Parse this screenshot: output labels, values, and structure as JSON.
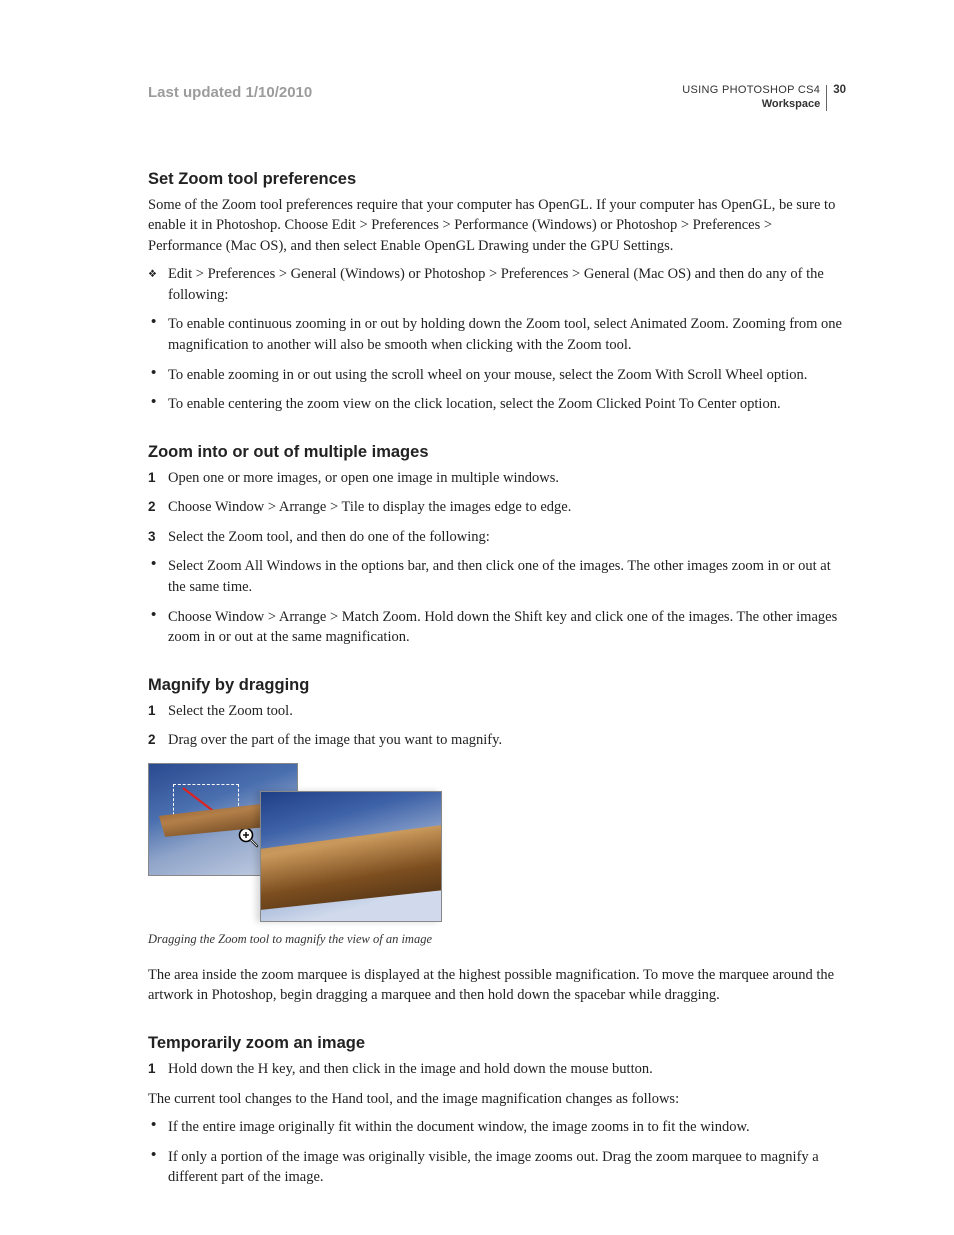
{
  "header": {
    "last_updated": "Last updated 1/10/2010",
    "product": "USING PHOTOSHOP CS4",
    "section": "Workspace",
    "page_number": "30"
  },
  "sections": {
    "zoom_prefs": {
      "title": "Set Zoom tool preferences",
      "intro": "Some of the Zoom tool preferences require that your computer has OpenGL. If your computer has OpenGL, be sure to enable it in Photoshop. Choose Edit > Preferences > Performance (Windows) or Photoshop > Preferences > Performance (Mac OS), and then select Enable OpenGL Drawing under the GPU Settings.",
      "diamond_item": "Edit > Preferences > General (Windows) or Photoshop > Preferences > General (Mac OS) and then do any of the following:",
      "bullets": [
        "To enable continuous zooming in or out by holding down the Zoom tool, select Animated Zoom. Zooming from one magnification to another will also be smooth when clicking with the Zoom tool.",
        "To enable zooming in or out using the scroll wheel on your mouse, select the Zoom With Scroll Wheel option.",
        "To enable centering the zoom view on the click location, select the Zoom Clicked Point To Center option."
      ]
    },
    "zoom_multi": {
      "title": "Zoom into or out of multiple images",
      "steps": [
        "Open one or more images, or open one image in multiple windows.",
        "Choose Window > Arrange > Tile to display the images edge to edge.",
        "Select the Zoom tool, and then do one of the following:"
      ],
      "bullets": [
        "Select Zoom All Windows in the options bar, and then click one of the images. The other images zoom in or out at the same time.",
        "Choose Window > Arrange > Match Zoom. Hold down the Shift key and click one of the images. The other images zoom in or out at the same magnification."
      ]
    },
    "magnify": {
      "title": "Magnify by dragging",
      "steps": [
        "Select the Zoom tool.",
        "Drag over the part of the image that you want to magnify."
      ],
      "caption": "Dragging the Zoom tool to magnify the view of an image",
      "after": "The area inside the zoom marquee is displayed at the highest possible magnification. To move the marquee around the artwork in Photoshop, begin dragging a marquee and then hold down the spacebar while dragging."
    },
    "temp_zoom": {
      "title": "Temporarily zoom an image",
      "step1": "Hold down the H key, and then click in the image and hold down the mouse button.",
      "after_step": "The current tool changes to the Hand tool, and the image magnification changes as follows:",
      "bullets": [
        "If the entire image originally fit within the document window, the image zooms in to fit the window.",
        "If only a portion of the image was originally visible, the image zooms out. Drag the zoom marquee to magnify a different part of the image."
      ]
    }
  }
}
